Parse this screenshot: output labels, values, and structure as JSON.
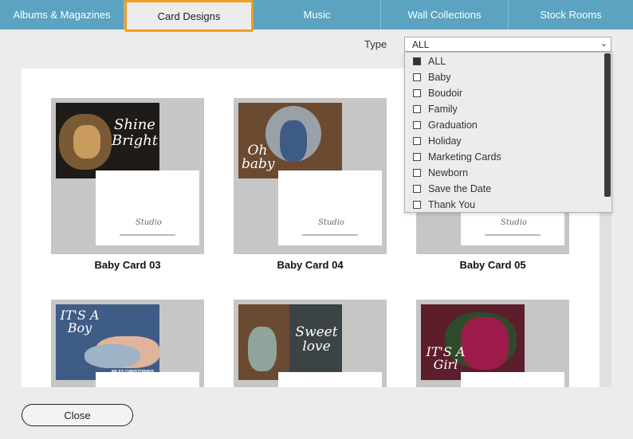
{
  "tabs": [
    {
      "label": "Albums & Magazines"
    },
    {
      "label": "Card Designs"
    },
    {
      "label": "Music"
    },
    {
      "label": "Wall Collections"
    },
    {
      "label": "Stock Rooms"
    }
  ],
  "filter": {
    "label": "Type",
    "selected": "ALL",
    "options": [
      "ALL",
      "Baby",
      "Boudoir",
      "Family",
      "Graduation",
      "Holiday",
      "Marketing Cards",
      "Newborn",
      "Save the Date",
      "Thank You"
    ]
  },
  "cards": [
    {
      "title": "Baby Card 03",
      "photo_text": "Shine Bright",
      "bg": "#1e1b18"
    },
    {
      "title": "Baby Card 04",
      "photo_text": "Oh baby",
      "bg": "#6b4a32"
    },
    {
      "title": "Baby Card 05",
      "photo_text": "",
      "bg": "#cfcfcf"
    },
    {
      "title": "",
      "photo_text": "IT'S A Boy",
      "bg": "#3f5c86",
      "name": "MILES CHRISTOPHER"
    },
    {
      "title": "",
      "photo_text": "Sweet love",
      "bg": "#3b4347"
    },
    {
      "title": "",
      "photo_text": "IT'S A Girl",
      "bg": "#5b1e2a"
    }
  ],
  "footer": {
    "close_label": "Close"
  },
  "colors": {
    "tab_bg": "#5ba3c1",
    "active_tab_border": "#f39c1e",
    "gallery_bg": "#ffffff"
  }
}
